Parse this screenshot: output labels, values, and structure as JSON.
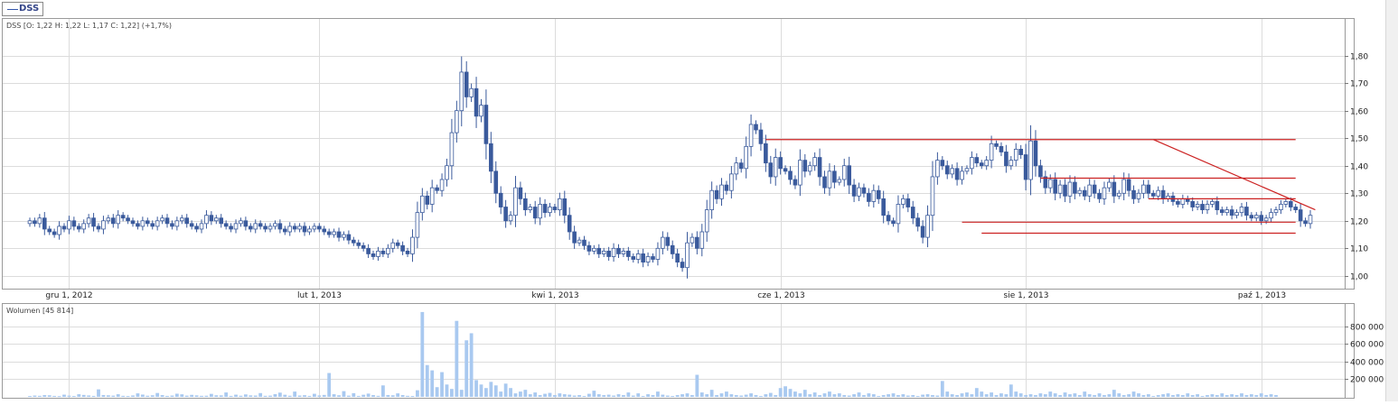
{
  "legend": {
    "symbol": "DSS"
  },
  "price_panel": {
    "header": "DSS [O: 1,22  H: 1,22  L: 1,17  C: 1,22] (+1,7%)"
  },
  "volume_panel": {
    "header": "Wolumen [45 814]"
  },
  "colors": {
    "up": "#ffffff",
    "down": "#3a5a9c",
    "line": "#3a5a9c",
    "trend": "#cc2222",
    "volume": "#a9c9f0",
    "grid": "#dcdcdc"
  },
  "chart_data": [
    {
      "type": "candlestick",
      "title": "DSS [O: 1,22  H: 1,22  L: 1,17  C: 1,22] (+1,7%)",
      "x_tick_labels": [
        "gru 1, 2012",
        "lut 1, 2013",
        "kwi 1, 2013",
        "cze 1, 2013",
        "sie 1, 2013",
        "paź 1, 2013"
      ],
      "x_tick_bar_index": [
        8,
        59,
        107,
        153,
        203,
        251
      ],
      "y_tick_labels": [
        "1,00",
        "1,10",
        "1,20",
        "1,30",
        "1,40",
        "1,50",
        "1,60",
        "1,70",
        "1,80"
      ],
      "y_ticks": [
        1.0,
        1.1,
        1.2,
        1.3,
        1.4,
        1.5,
        1.6,
        1.7,
        1.8
      ],
      "ylim": [
        0.97,
        1.92
      ],
      "grid": true,
      "last_bar": {
        "open": 1.22,
        "high": 1.22,
        "low": 1.17,
        "close": 1.22,
        "change_pct": 1.7
      },
      "close": [
        1.2,
        1.19,
        1.21,
        1.17,
        1.16,
        1.15,
        1.18,
        1.17,
        1.2,
        1.18,
        1.17,
        1.19,
        1.21,
        1.18,
        1.17,
        1.2,
        1.21,
        1.19,
        1.22,
        1.21,
        1.2,
        1.19,
        1.18,
        1.2,
        1.19,
        1.18,
        1.2,
        1.21,
        1.19,
        1.18,
        1.2,
        1.21,
        1.19,
        1.18,
        1.17,
        1.19,
        1.22,
        1.2,
        1.21,
        1.19,
        1.18,
        1.17,
        1.19,
        1.2,
        1.18,
        1.17,
        1.19,
        1.18,
        1.17,
        1.18,
        1.19,
        1.17,
        1.16,
        1.18,
        1.17,
        1.18,
        1.16,
        1.17,
        1.18,
        1.17,
        1.16,
        1.15,
        1.16,
        1.14,
        1.15,
        1.13,
        1.12,
        1.11,
        1.1,
        1.08,
        1.07,
        1.09,
        1.08,
        1.1,
        1.12,
        1.11,
        1.09,
        1.08,
        1.14,
        1.23,
        1.29,
        1.26,
        1.32,
        1.31,
        1.35,
        1.4,
        1.52,
        1.6,
        1.74,
        1.65,
        1.68,
        1.58,
        1.62,
        1.48,
        1.38,
        1.3,
        1.25,
        1.2,
        1.22,
        1.32,
        1.28,
        1.24,
        1.25,
        1.21,
        1.26,
        1.23,
        1.25,
        1.24,
        1.28,
        1.22,
        1.16,
        1.12,
        1.13,
        1.11,
        1.09,
        1.1,
        1.08,
        1.09,
        1.07,
        1.1,
        1.08,
        1.09,
        1.07,
        1.06,
        1.08,
        1.05,
        1.07,
        1.06,
        1.1,
        1.14,
        1.11,
        1.08,
        1.05,
        1.03,
        1.12,
        1.14,
        1.1,
        1.16,
        1.24,
        1.31,
        1.28,
        1.33,
        1.31,
        1.37,
        1.41,
        1.39,
        1.47,
        1.55,
        1.53,
        1.48,
        1.41,
        1.36,
        1.43,
        1.39,
        1.38,
        1.35,
        1.33,
        1.42,
        1.38,
        1.4,
        1.43,
        1.36,
        1.32,
        1.38,
        1.34,
        1.35,
        1.4,
        1.33,
        1.29,
        1.32,
        1.3,
        1.27,
        1.31,
        1.28,
        1.22,
        1.2,
        1.19,
        1.26,
        1.28,
        1.25,
        1.21,
        1.18,
        1.14,
        1.22,
        1.36,
        1.42,
        1.4,
        1.37,
        1.39,
        1.35,
        1.38,
        1.39,
        1.43,
        1.41,
        1.4,
        1.42,
        1.48,
        1.47,
        1.45,
        1.4,
        1.42,
        1.46,
        1.44,
        1.35,
        1.49,
        1.4,
        1.36,
        1.32,
        1.35,
        1.3,
        1.33,
        1.29,
        1.34,
        1.3,
        1.31,
        1.29,
        1.33,
        1.3,
        1.28,
        1.32,
        1.34,
        1.29,
        1.3,
        1.35,
        1.31,
        1.28,
        1.3,
        1.33,
        1.3,
        1.29,
        1.31,
        1.28,
        1.29,
        1.27,
        1.26,
        1.28,
        1.27,
        1.25,
        1.26,
        1.24,
        1.26,
        1.27,
        1.24,
        1.23,
        1.24,
        1.22,
        1.23,
        1.25,
        1.22,
        1.21,
        1.22,
        1.2,
        1.21,
        1.23,
        1.24,
        1.26,
        1.27,
        1.25,
        1.24,
        1.2,
        1.19,
        1.22
      ]
    },
    {
      "type": "bar",
      "title": "Wolumen [45 814]",
      "y_tick_labels": [
        "200 000",
        "400 000",
        "600 000",
        "800 000"
      ],
      "y_ticks": [
        200000,
        400000,
        600000,
        800000
      ],
      "ylim": [
        0,
        1000000
      ],
      "volume_k": [
        10,
        15,
        12,
        20,
        18,
        11,
        9,
        25,
        14,
        10,
        30,
        22,
        16,
        11,
        85,
        21,
        18,
        14,
        30,
        12,
        10,
        16,
        40,
        26,
        13,
        18,
        44,
        20,
        11,
        15,
        36,
        29,
        14,
        23,
        17,
        12,
        13,
        34,
        18,
        17,
        50,
        11,
        25,
        13,
        28,
        17,
        15,
        43,
        12,
        14,
        31,
        48,
        24,
        13,
        60,
        15,
        19,
        11,
        35,
        16,
        22,
        270,
        30,
        18,
        65,
        14,
        42,
        11,
        24,
        37,
        20,
        12,
        130,
        21,
        18,
        40,
        20,
        12,
        10,
        75,
        960,
        360,
        300,
        110,
        280,
        140,
        90,
        860,
        80,
        640,
        720,
        190,
        140,
        100,
        170,
        130,
        60,
        150,
        100,
        40,
        60,
        80,
        30,
        50,
        20,
        35,
        45,
        20,
        40,
        30,
        25,
        15,
        20,
        10,
        35,
        70,
        30,
        20,
        25,
        15,
        30,
        20,
        50,
        15,
        40,
        10,
        30,
        20,
        60,
        25,
        15,
        10,
        20,
        30,
        40,
        20,
        250,
        50,
        30,
        80,
        20,
        40,
        60,
        30,
        20,
        15,
        25,
        40,
        20,
        10,
        30,
        45,
        20,
        100,
        120,
        90,
        60,
        40,
        80,
        30,
        50,
        20,
        40,
        60,
        30,
        40,
        20,
        15,
        30,
        50,
        20,
        40,
        30,
        10,
        20,
        30,
        40,
        20,
        30,
        15,
        20,
        10,
        25,
        30,
        20,
        15,
        180,
        60,
        30,
        20,
        40,
        50,
        30,
        100,
        60,
        30,
        50,
        20,
        40,
        30,
        140,
        60,
        40,
        20,
        30,
        20,
        40,
        30,
        60,
        40,
        20,
        50,
        30,
        40,
        20,
        60,
        30,
        20,
        40,
        20,
        30,
        80,
        40,
        20,
        30,
        60,
        40,
        20,
        30,
        10,
        20,
        30,
        40,
        20,
        30,
        20,
        40,
        20,
        30,
        10,
        20,
        30,
        20,
        40,
        20,
        30,
        20,
        40,
        20,
        30,
        20,
        40,
        20,
        30,
        20
      ]
    }
  ]
}
